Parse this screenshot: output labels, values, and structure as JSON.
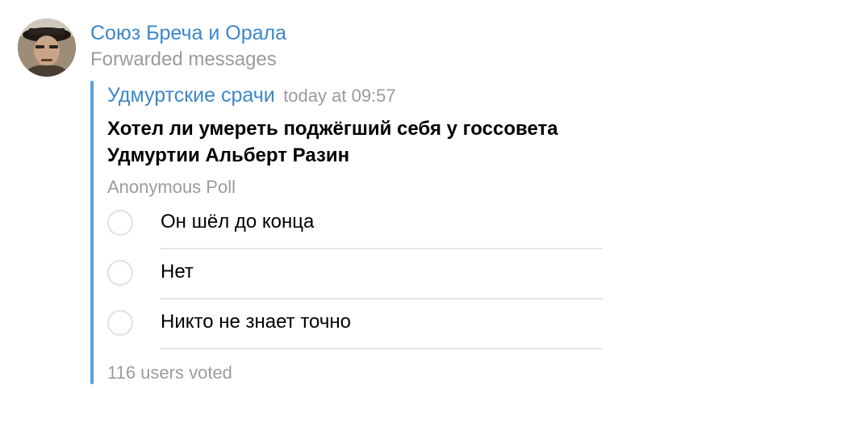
{
  "message": {
    "sender": "Союз Бреча и Орала",
    "forward_label": "Forwarded messages",
    "accent_color": "#3d87c8",
    "forwarded": {
      "from": "Удмуртские срачи",
      "time": "today at 09:57",
      "poll": {
        "question": "Хотел ли умереть поджёгший себя у госсовета Удмуртии Альберт Разин",
        "type": "Anonymous Poll",
        "options": [
          {
            "label": "Он шёл до конца"
          },
          {
            "label": "Нет"
          },
          {
            "label": "Никто не знает точно"
          }
        ],
        "votes": "116 users voted"
      }
    }
  }
}
